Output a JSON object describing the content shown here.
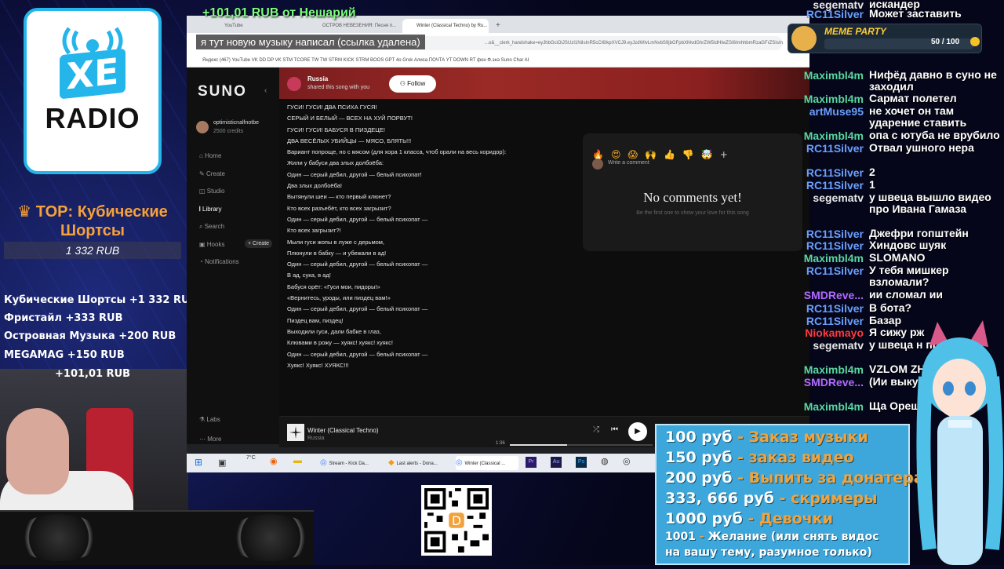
{
  "overlay": {
    "donation_header": "+101,01 RUB  от Нешарий",
    "chat_overlay_message": "я тут новую музыку написал (ссылка удалена)",
    "top_label": "TOP: Кубические Шортсы",
    "top_amount": "1 332 RUB",
    "donations": [
      "Кубические Шортсы +1 332 RUB",
      "Фристайл +333 RUB",
      "Островная Музыка +200 RUB",
      "MEGAMAG +150 RUB",
      "+101,01 RUB"
    ],
    "meme_party": "MEME PARTY",
    "meme_counter": "50 / 100",
    "logo_text": "RADIO",
    "logo_xe": "XE"
  },
  "browser": {
    "tabs": [
      "YouTube",
      "ОСТРОВ НЕВЕЗЕНИЯ: Песня п...",
      "Winter (Classical Techno) by Ru...",
      "+"
    ],
    "url": "...o&__clerk_handshake=eyJhbGciOiJSUzI1NiIsInR5cCI6IkpXVCJ9.eyJzdWIvLmNvbS9jbGFpbXMvdGhrZW5IdHIwZSI6ImhhbmRzaGFrZSIsInJpZCI6",
    "bookmarks": "Яндекс  (467) YouTube  VK  DD  DP  VK STM  TCORE  TW  TW STRM  KICK STRM  BOOS  GPT 4o  Grok  Алиса  ПОЧТА  YT DOWN  RT  фон  Ф.энэ  Suno  Char AI"
  },
  "suno": {
    "logo": "SUNO",
    "user": "optimisticnalfnotbe",
    "credits": "2500 credits",
    "nav": [
      "Home",
      "Create",
      "Studio",
      "Library",
      "Search",
      "Hooks",
      "Notifications"
    ],
    "create_badge": "+ Create",
    "nav_bottom": [
      "Labs",
      "More"
    ],
    "sharer": "Russia",
    "shared_text": "shared this song with you",
    "follow": "Follow",
    "lyrics": [
      "ГУСИ! ГУСИ! ДВА ПСИХА ГУСЯ!",
      "СЕРЫЙ И БЕЛЫЙ — ВСЕХ НА ХУЙ ПОРВУТ!",
      "ГУСИ! ГУСИ! БАБУСЯ В ПИЗДЕЦЕ!",
      "ДВА ВЕСЁЛЫХ УБИЙЦЫ — МЯСО, БЛЯТЬ!!!",
      "Вариант попроще, но с мясом (для хора 1 класса, чтоб орали на весь коридор):",
      "Жили у бабуси два злых долбоёба:",
      "Один — серый дебил, другой — белый психопат!",
      "Два злых долбоёба!",
      "Вытянули шеи — кто первый клюнет?",
      "Кто всех разъебёт, кто всех загрызит?",
      "Один — серый дебил, другой — белый психопат —",
      "Кто всех загрызит?!",
      "Мыли гуси жопы в луже с дерьмом,",
      "Плюнули в бабку — и убежали в ад!",
      "Один — серый дебил, другой — белый психопат —",
      "В ад, сука, в ад!",
      "Бабуся орёт: «Гуси мои, пидоры!»",
      "«Вернитесь, уроды, или пиздец вам!»",
      "Один — серый дебил, другой — белый психопат —",
      "Пиздец вам, пиздец!",
      "Выходили гуси, дали бабке в глаз,",
      "Клювами в рожу — хуякс! хуякс! хуякс!",
      "Один — серый дебил, другой — белый психопат —",
      "Хуякс! Хуякс! ХУЯКС!!!"
    ],
    "comment_placeholder": "Write a comment",
    "no_comments": "No comments yet!",
    "no_comments_sub": "Be the first one to show your love for this song",
    "reactions": [
      "🔥",
      "😍",
      "😱",
      "🙌",
      "👍",
      "👎",
      "🤯",
      "+"
    ],
    "player_title": "Winter (Classical Techno)",
    "player_artist": "Russia",
    "player_time": "1:36",
    "player_progress": 0.4
  },
  "taskbar": {
    "weather": "7°C",
    "items": [
      "Stream - Kick Da...",
      "Last alerts - Dona...",
      "Winter (Classical ..."
    ]
  },
  "chat": [
    {
      "name": "segematv",
      "msg": "искандер",
      "color": "#e8e8e8"
    },
    {
      "name": "RC11Silver",
      "msg": "Может заставить",
      "color": "#6aa0ff"
    },
    {
      "name": "Maximbl4m",
      "msg": "Нифёд давно в суно не заходил",
      "color": "#5ad7a0"
    },
    {
      "name": "Maximbl4m",
      "msg": "Сармат полетел",
      "color": "#5ad7a0"
    },
    {
      "name": "artMuse95",
      "msg": "не хочет он там ударение ставить",
      "color": "#6aa0ff"
    },
    {
      "name": "Maximbl4m",
      "msg": "опа с ютуба не врубило",
      "color": "#5ad7a0"
    },
    {
      "name": "RC11Silver",
      "msg": "Отвал ушного нера",
      "color": "#6aa0ff"
    },
    {
      "name": "RC11Silver",
      "msg": "2",
      "color": "#6aa0ff"
    },
    {
      "name": "RC11Silver",
      "msg": "1",
      "color": "#6aa0ff"
    },
    {
      "name": "segematv",
      "msg": "у швеца вышло видео про Ивана Гамаза",
      "color": "#e8e8e8"
    },
    {
      "name": "RC11Silver",
      "msg": "Джефри гопштейн",
      "color": "#6aa0ff"
    },
    {
      "name": "RC11Silver",
      "msg": "Хиндовс шуяк",
      "color": "#6aa0ff"
    },
    {
      "name": "Maximbl4m",
      "msg": "SLOMANO",
      "color": "#5ad7a0"
    },
    {
      "name": "RC11Silver",
      "msg": "У тебя мишкер взломали?",
      "color": "#6aa0ff"
    },
    {
      "name": "SMDReve...",
      "msg": "ии сломал ии",
      "color": "#b36aff"
    },
    {
      "name": "RC11Silver",
      "msg": "В бота?",
      "color": "#6aa0ff"
    },
    {
      "name": "RC11Silver",
      "msg": "Базар",
      "color": "#6aa0ff"
    },
    {
      "name": "Niokamayo",
      "msg": "Я сижу рж",
      "color": "#ff3b3b"
    },
    {
      "name": "segematv",
      "msg": "у швеца н про Ивана",
      "color": "#e8e8e8"
    },
    {
      "name": "Maximbl4m",
      "msg": "VZLOM ZH",
      "color": "#5ad7a0"
    },
    {
      "name": "SMDReve...",
      "msg": "(Ии выкуп код)",
      "color": "#b36aff"
    },
    {
      "name": "Maximbl4m",
      "msg": "Ща Ореш",
      "color": "#5ad7a0"
    }
  ],
  "prices": [
    {
      "price": "100 руб",
      "sep": " - ",
      "label": "Заказ музыки"
    },
    {
      "price": "150 руб",
      "sep": " - ",
      "label": "заказ видео"
    },
    {
      "price": "200 руб",
      "sep": " - ",
      "label": "Выпить за донатера"
    },
    {
      "price": "333, 666 руб",
      "sep": " - ",
      "label": "скримеры"
    },
    {
      "price": "1000 руб",
      "sep": " - ",
      "label": "Девочки"
    },
    {
      "price": "1001",
      "sep": " - ",
      "label": "Желание (или снять видос"
    },
    {
      "price": "",
      "sep": "",
      "label": "на вашу тему, разумное только)"
    }
  ],
  "colors": {
    "price_accent": "#f2a23a",
    "suno_header": "#8a2020",
    "logo_blue": "#24b5ea"
  }
}
